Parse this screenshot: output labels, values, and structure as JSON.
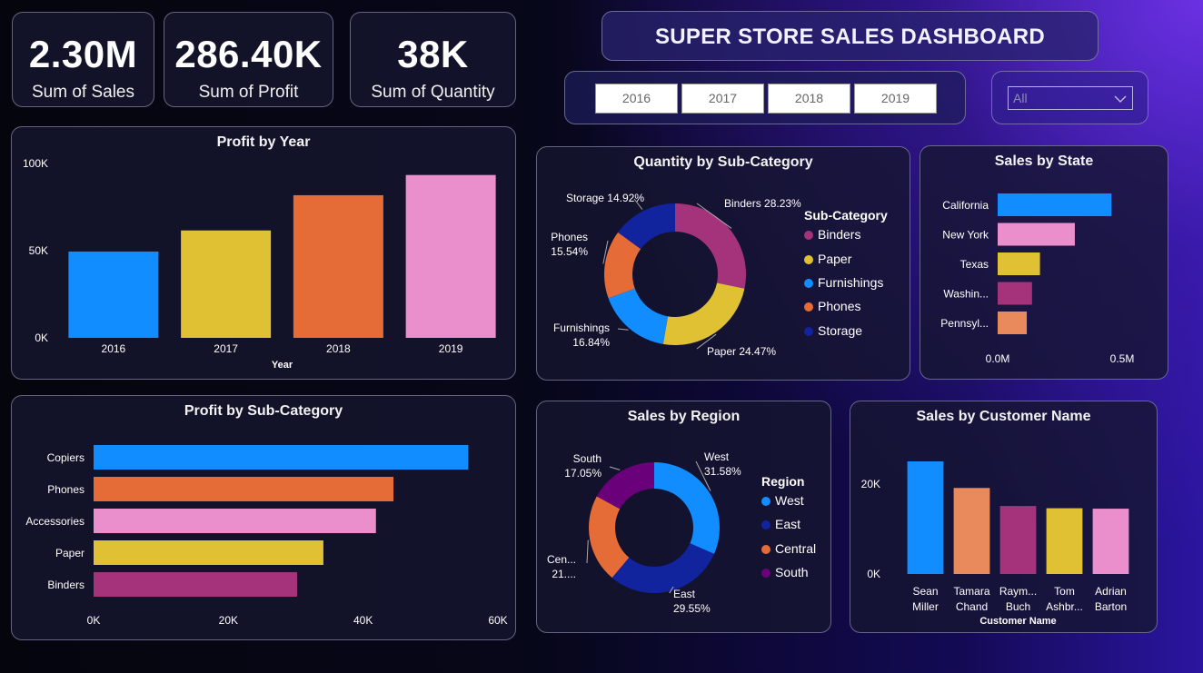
{
  "title": "SUPER STORE SALES DASHBOARD",
  "kpis": [
    {
      "value": "2.30M",
      "label": "Sum of Sales"
    },
    {
      "value": "286.40K",
      "label": "Sum of Profit"
    },
    {
      "value": "38K",
      "label": "Sum of Quantity"
    }
  ],
  "year_filter": {
    "options": [
      "2016",
      "2017",
      "2018",
      "2019"
    ]
  },
  "dropdown": {
    "selected": "All"
  },
  "colors": {
    "blue": "#118DFF",
    "yellow": "#E0C134",
    "orange": "#E66C37",
    "pink": "#EA8FCC",
    "magenta": "#A4337C",
    "navy": "#12239E",
    "purple": "#6B007B",
    "salmon": "#E98A5C"
  },
  "chart_data": [
    {
      "id": "profit_by_year",
      "type": "bar",
      "title": "Profit by Year",
      "xlabel": "Year",
      "categories": [
        "2016",
        "2017",
        "2018",
        "2019"
      ],
      "values": [
        49500,
        61600,
        81800,
        93400
      ],
      "colors": [
        "#118DFF",
        "#E0C134",
        "#E66C37",
        "#EA8FCC"
      ],
      "ylim": [
        0,
        100000
      ],
      "yticks": [
        "0K",
        "50K",
        "100K"
      ]
    },
    {
      "id": "profit_by_subcategory",
      "type": "bar",
      "orientation": "horizontal",
      "title": "Profit by Sub-Category",
      "categories": [
        "Copiers",
        "Phones",
        "Accessories",
        "Paper",
        "Binders"
      ],
      "values": [
        55600,
        44500,
        41900,
        34100,
        30200
      ],
      "colors": [
        "#118DFF",
        "#E66C37",
        "#EA8FCC",
        "#E0C134",
        "#A4337C"
      ],
      "xlim": [
        0,
        60000
      ],
      "xticks": [
        "0K",
        "20K",
        "40K",
        "60K"
      ]
    },
    {
      "id": "quantity_by_subcategory",
      "type": "pie",
      "donut": true,
      "title": "Quantity by Sub-Category",
      "legend_title": "Sub-Category",
      "labels": [
        "Binders",
        "Paper",
        "Furnishings",
        "Phones",
        "Storage"
      ],
      "values": [
        28.23,
        24.47,
        16.84,
        15.54,
        14.92
      ],
      "data_labels": [
        "Binders 28.23%",
        "Paper 24.47%",
        "Furnishings 16.84%",
        "Phones 15.54%",
        "Storage 14.92%"
      ],
      "colors": [
        "#A4337C",
        "#E0C134",
        "#118DFF",
        "#E66C37",
        "#12239E"
      ]
    },
    {
      "id": "sales_by_state",
      "type": "bar",
      "orientation": "horizontal",
      "title": "Sales by State",
      "categories": [
        "California",
        "New York",
        "Texas",
        "Washin...",
        "Pennsyl..."
      ],
      "values": [
        457000,
        310000,
        170000,
        138000,
        117000
      ],
      "colors": [
        "#118DFF",
        "#EA8FCC",
        "#E0C134",
        "#A4337C",
        "#E98A5C"
      ],
      "xlim": [
        0,
        500000
      ],
      "xticks": [
        "0.0M",
        "0.5M"
      ]
    },
    {
      "id": "sales_by_region",
      "type": "pie",
      "donut": true,
      "title": "Sales by Region",
      "legend_title": "Region",
      "labels": [
        "West",
        "East",
        "Central",
        "South"
      ],
      "values": [
        31.58,
        29.55,
        21.82,
        17.05
      ],
      "data_labels": [
        "West 31.58%",
        "East 29.55%",
        "Cen... 21....",
        "South 17.05%"
      ],
      "colors": [
        "#118DFF",
        "#12239E",
        "#E66C37",
        "#6B007B"
      ]
    },
    {
      "id": "sales_by_customer",
      "type": "bar",
      "title": "Sales by Customer Name",
      "xlabel": "Customer Name",
      "categories": [
        "Sean Miller",
        "Tamara Chand",
        "Raym... Buch",
        "Tom Ashbr...",
        "Adrian Barton"
      ],
      "values": [
        25000,
        19100,
        15100,
        14600,
        14500
      ],
      "colors": [
        "#118DFF",
        "#E98A5C",
        "#A4337C",
        "#E0C134",
        "#EA8FCC"
      ],
      "ylim": [
        0,
        25000
      ],
      "yticks": [
        "0K",
        "20K"
      ]
    }
  ]
}
